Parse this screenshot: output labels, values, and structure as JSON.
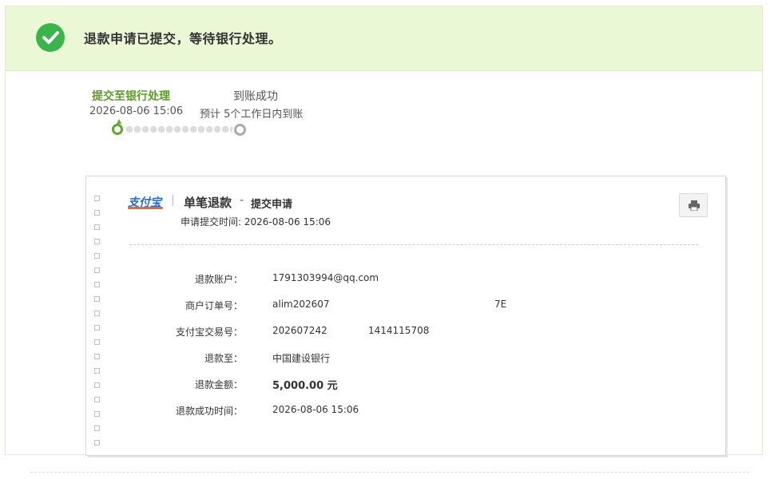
{
  "banner": {
    "message": "退款申请已提交，等待银行处理。",
    "icon": "check-circle-icon",
    "accent_color": "#3bb54a",
    "background_color": "#eaf8d6"
  },
  "progress": {
    "steps": [
      {
        "label": "提交至银行处理",
        "detail": "2026-08-06 15:06",
        "status": "done"
      },
      {
        "label": "到账成功",
        "detail": "预计 5个工作日内到账",
        "status": "pending"
      }
    ],
    "done_color": "#5ea82a",
    "pending_color": "#aaaaaa"
  },
  "receipt": {
    "logo_text": "支付宝",
    "separator": "|",
    "title": "单笔退款",
    "dash": "-",
    "subtitle": "提交申请",
    "submit_time_label": "申请提交时间:",
    "submit_time_value": "2026-08-06 15:06",
    "print_icon": "printer-icon",
    "rows": [
      {
        "label": "退款账户：",
        "value": "1791303994@qq.com"
      },
      {
        "label": "商户订单号：",
        "value": "alim202607",
        "value_tail": "7E"
      },
      {
        "label": "支付宝交易号：",
        "value": "2026072​42",
        "value_tail": "1414115708"
      },
      {
        "label": "退款至：",
        "value": "中国建设银行"
      },
      {
        "label": "退款金额：",
        "value": "5,000.00 元"
      },
      {
        "label": "退款成功时间：",
        "value": "2026-08-06 15:06"
      }
    ]
  }
}
